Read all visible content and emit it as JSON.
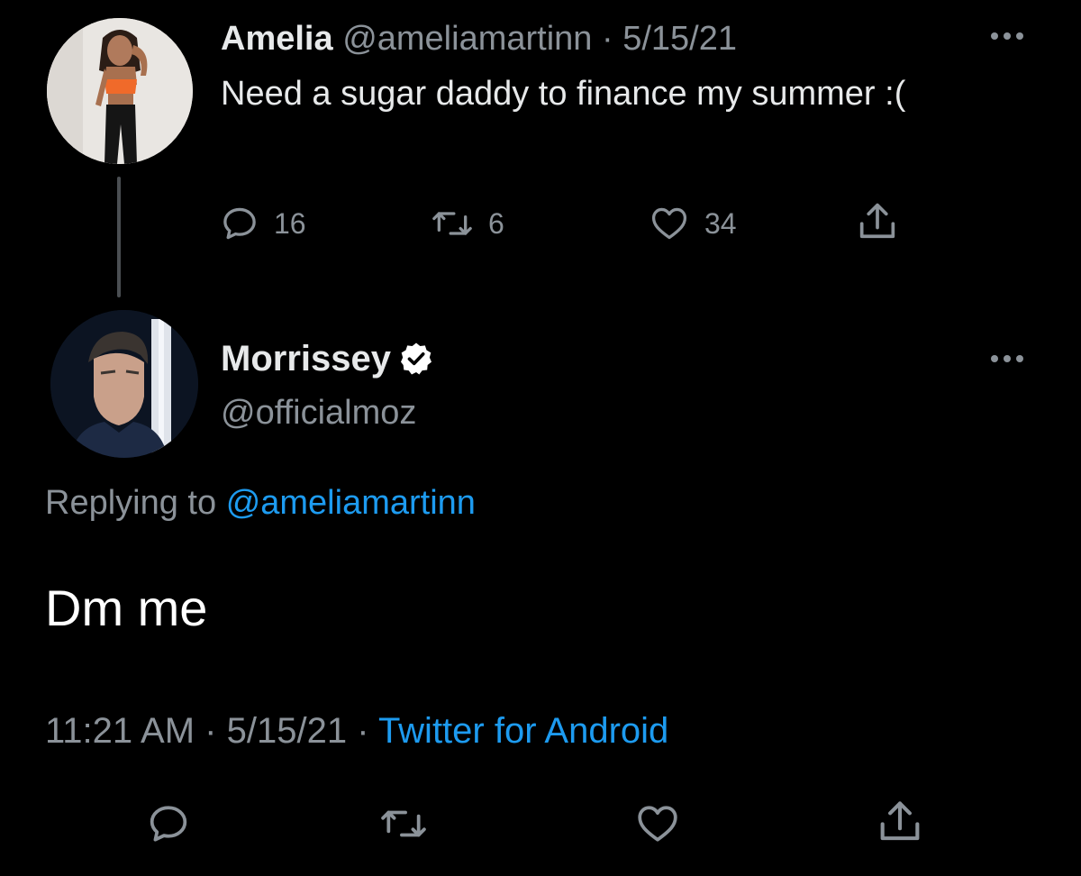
{
  "colors": {
    "background": "#000000",
    "text_primary": "#e7e9ea",
    "text_secondary": "#8b9299",
    "link": "#1d9bf0",
    "verified_badge": "#ffffff"
  },
  "parent_tweet": {
    "author_name": "Amelia",
    "author_handle": "@ameliamartinn",
    "separator": "·",
    "date": "5/15/21",
    "text": "Need a sugar daddy to finance my summer :(",
    "counts": {
      "replies": "16",
      "retweets": "6",
      "likes": "34"
    },
    "icons": [
      "reply-icon",
      "retweet-icon",
      "like-icon",
      "share-icon",
      "more-options-icon"
    ]
  },
  "reply_tweet": {
    "author_name": "Morrissey",
    "author_handle": "@officialmoz",
    "verified": true,
    "replying_prefix": "Replying to",
    "replying_handle": "@ameliamartinn",
    "text": "Dm me",
    "time": "11:21 AM",
    "separator": "·",
    "date": "5/15/21",
    "source": "Twitter for Android",
    "icons": [
      "reply-icon",
      "retweet-icon",
      "like-icon",
      "share-icon",
      "more-options-icon",
      "verified-badge-icon"
    ]
  }
}
